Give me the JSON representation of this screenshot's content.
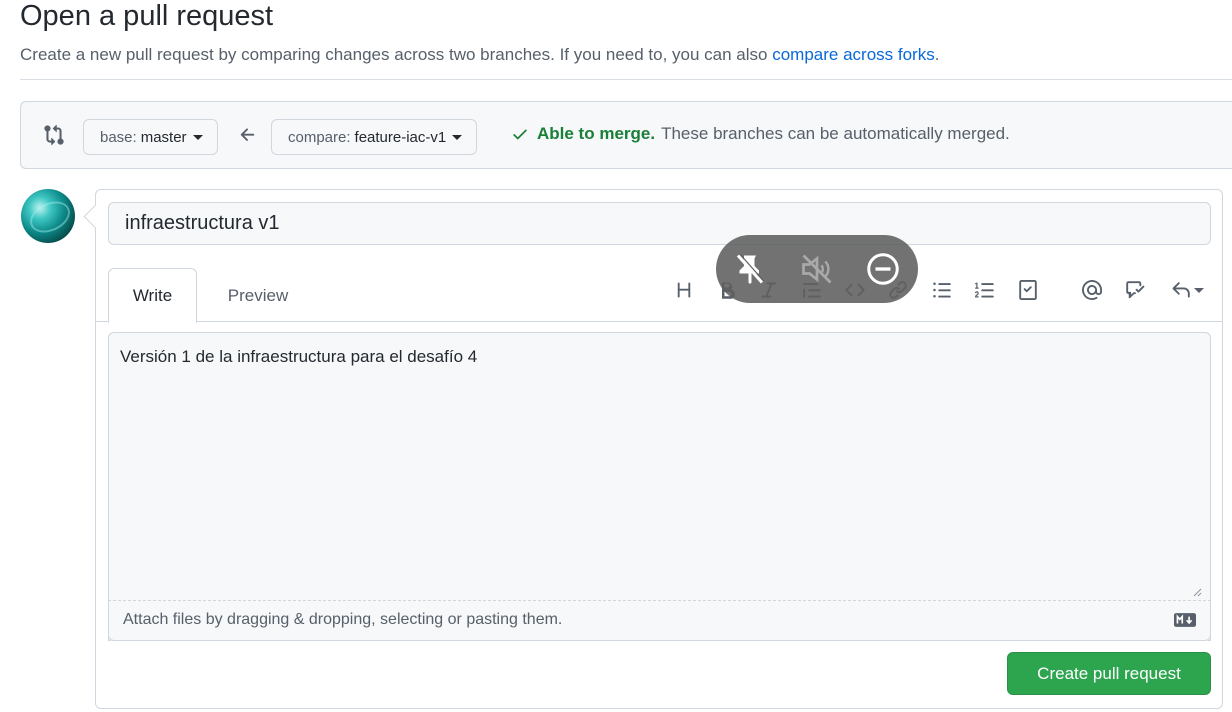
{
  "header": {
    "title": "Open a pull request",
    "subtitle": "Create a new pull request by comparing changes across two branches. If you need to, you can also ",
    "subtitle_link": "compare across forks",
    "subtitle_end": "."
  },
  "range": {
    "base_prefix": "base:",
    "base_branch": "master",
    "compare_prefix": "compare:",
    "compare_branch": "feature-iac-v1",
    "merge_ok": "Able to merge.",
    "merge_message": "These branches can be automatically merged."
  },
  "composer": {
    "title_value": "infraestructura v1",
    "tabs": [
      "Write",
      "Preview"
    ],
    "toolbar": [
      "heading-icon",
      "bold-icon",
      "italic-icon",
      "quote-icon",
      "code-icon",
      "link-icon",
      "unordered-list-icon",
      "ordered-list-icon",
      "task-list-icon",
      "mention-icon",
      "cross-reference-icon",
      "reply-icon"
    ],
    "body_value": "Versión 1 de la infraestructura para el desafío 4",
    "attach_text": "Attach files by dragging & dropping, selecting or pasting them.",
    "submit_label": "Create pull request"
  },
  "overlay": {
    "icons": [
      "pin-off-icon",
      "mute-icon",
      "minus-circle-icon"
    ]
  },
  "colors": {
    "link": "#0969da",
    "success": "#1a7f37",
    "button": "#2da44e"
  }
}
